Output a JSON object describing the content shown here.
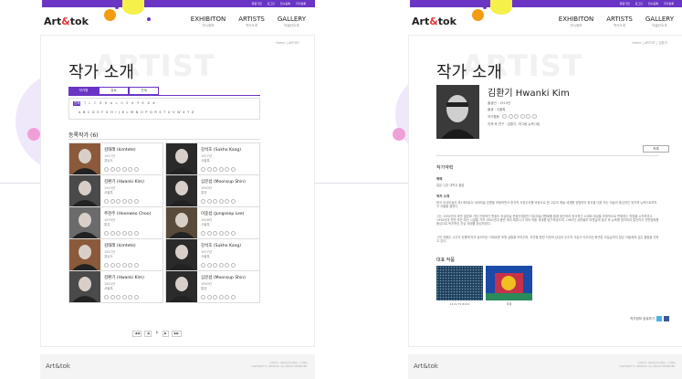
{
  "site": {
    "logo_main": "Art",
    "logo_amp": "&",
    "logo_end": "tok",
    "top_links": [
      "회원가입",
      "로그인",
      "전시등록",
      "작가등록"
    ],
    "nav": [
      {
        "en": "EXHIBITON",
        "ko": "전시정보"
      },
      {
        "en": "ARTISTS",
        "ko": "작가소개"
      },
      {
        "en": "GALLERY",
        "ko": "미술관소개"
      }
    ],
    "footer_logo": "Art&tok",
    "footer_lines": [
      "이용약관 | 개인정보처리방침 | 고객센터",
      "COPYRIGHT © ART&TOK. ALL RIGHTS RESERVED."
    ]
  },
  "list_page": {
    "breadcrumb": "Home | ARTIST",
    "watermark": "ARTIST",
    "title": "작가 소개",
    "tabs": [
      "작가명",
      "장르",
      "관계"
    ],
    "index_row1": [
      "전체",
      "ㄱ",
      "ㄴ",
      "ㄷ",
      "ㄹ",
      "ㅁ",
      "ㅂ",
      "ㅅ",
      "ㅇ",
      "ㅈ",
      "ㅊ",
      "ㅋ",
      "ㅌ",
      "ㅍ",
      "ㅎ"
    ],
    "index_row2": [
      "A",
      "B",
      "C",
      "D",
      "E",
      "F",
      "G",
      "H",
      "I",
      "J",
      "K",
      "L",
      "M",
      "N",
      "O",
      "P",
      "Q",
      "R",
      "S",
      "T",
      "U",
      "V",
      "W",
      "X",
      "Y",
      "Z"
    ],
    "registered": "등록작가 (6)",
    "cards": [
      {
        "name": "김태래 (kimtete)",
        "year": "1917년",
        "loc": "경남도"
      },
      {
        "name": "강석호 (Sukho Kang)",
        "year": "1977년",
        "loc": "서울특"
      },
      {
        "name": "김환기 (Hwanki Kim)",
        "year": "1913년",
        "loc": "서울특"
      },
      {
        "name": "심문섭 (Moonsup Shin)",
        "year": "1943년",
        "loc": "통영"
      },
      {
        "name": "추현주 (Heonweo Choo)",
        "year": "1970년",
        "loc": "통영"
      },
      {
        "name": "이중섭 (Jungseop Lee)",
        "year": "1916년",
        "loc": "서울특"
      },
      {
        "name": "김태래 (kimtete)",
        "year": "1917년",
        "loc": "경남도"
      },
      {
        "name": "강석호 (Sukho Kang)",
        "year": "1977년",
        "loc": "서울특"
      },
      {
        "name": "김환기 (Hwanki Kim)",
        "year": "1913년",
        "loc": "서울특"
      },
      {
        "name": "심문섭 (Moonsup Shin)",
        "year": "1943년",
        "loc": "통영"
      }
    ],
    "pager": [
      "◀◀",
      "◀",
      "1",
      "▶",
      "▶▶"
    ]
  },
  "detail_page": {
    "breadcrumb": "Home | ARTIST | 김환기",
    "watermark": "ARTIST",
    "title": "작가 소개",
    "name": "김환기 Hwanki Kim",
    "info": [
      "출생년 : 1913년",
      "출생 : 서울특",
      "작가활동"
    ],
    "info_extra": "전체 후 연구 : 김환기, 여그림 뉴욕그림",
    "list_button": "목록",
    "section_history": "작가약력",
    "sub_edu": "학력",
    "edu_text": "일본 니혼 대학교 졸업",
    "sub_intro": "작가 소개",
    "intro_text1": "한국 추상미술의 제1세대로서 세계미술 흐름을 포용하면서 한국적 서정주의를 바탕으로 한 고유의 예술 세계를 정립하여 한국을 대표 하는 미술의 중심적인 위치에 뉴욕으로까지 고 서울을 올렸다.",
    "intro_text2": "그는 1930년대 후반 일본에 가장 전위적인 활동이 추상미술 운동단체였던 자유미술가협회를 통해 등단하여 한국적인 소재와 대상을 조형적으로 변용하는 작업을 시작하였고, 1950년대 전반 부산 피난 시절을 거쳐 1950년대 중반 파리 체류시기 여러 작품 세계를 탐구하였으며, 1963년 상파울루 비엔날레 참여 후 뉴욕에 정착하여 말년까지 전면점화를 중심으로 독자적인 추상 세계를 완성하였다.",
    "intro_text3": "그의 작품은 시간의 흐름에 따라 달라지는 다채로운 조형 실험을 보여주며, 자연을 향한 서정적 감성과 우주적 사유가 어우러진 화면은 오늘날까지 많은 이들에게 깊은 울림을 전하고 있다.",
    "section_works": "대표 작품",
    "works": [
      {
        "caption": "13-IV-73 #131"
      },
      {
        "caption": "무제"
      }
    ],
    "share_label": "작가정보 공유하기"
  },
  "colors": {
    "accent": "#6a35c4",
    "orange": "#f39c12",
    "pink": "#f0a0d8",
    "cyan": "#b8f2f2",
    "yellow": "#f5f04a"
  }
}
